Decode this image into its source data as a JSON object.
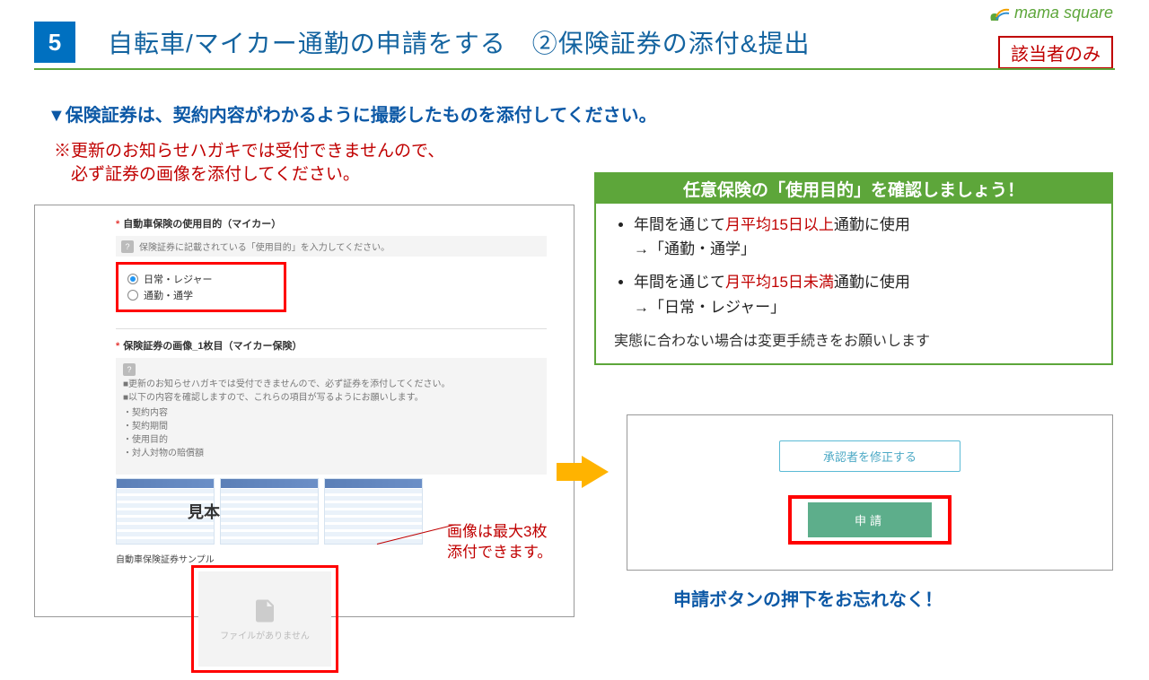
{
  "header": {
    "number": "5",
    "title": "自転車/マイカー通勤の申請をする　②保険証券の添付&提出",
    "logo_text": "mama square",
    "tag": "該当者のみ"
  },
  "instruction": {
    "main": "▼保険証券は、契約内容がわかるように撮影したものを添付してください。",
    "warn_l1": "※更新のお知らせハガキでは受付できませんので、",
    "warn_l2": "　必ず証券の画像を添付してください。"
  },
  "left": {
    "section1_label": "自動車保険の使用目的（マイカー）",
    "section1_note": "保険証券に記載されている「使用目的」を入力してください。",
    "radio1": "日常・レジャー",
    "radio2": "通勤・通学",
    "section2_label": "保険証券の画像_1枚目（マイカー保険）",
    "section2_note_l1": "■更新のお知らせハガキでは受付できませんので、必ず証券を添付してください。",
    "section2_note_l2": "■以下の内容を確認しますので、これらの項目が写るようにお願いします。",
    "bullets": [
      "・契約内容",
      "・契約期間",
      "・使用目的",
      "・対人対物の賠償額"
    ],
    "sample_overlay": "見本",
    "sample_caption": "自動車保険証券サンプル",
    "file_placeholder": "ファイルがありません"
  },
  "callout": {
    "l1": "画像は最大3枚",
    "l2": "添付できます。"
  },
  "info": {
    "header": "任意保険の「使用目的」を確認しましょう！",
    "item1_pre": "年間を通じて",
    "item1_red": "月平均15日以上",
    "item1_post": "通勤に使用",
    "item1_arrow": "→「通勤・通学」",
    "item2_pre": "年間を通じて",
    "item2_red": "月平均15日未満",
    "item2_post": "通勤に使用",
    "item2_arrow": "→「日常・レジャー」",
    "foot": "実態に合わない場合は変更手続きをお願いします"
  },
  "right": {
    "edit_btn": "承認者を修正する",
    "submit_btn": "申請"
  },
  "submit_note": "申請ボタンの押下をお忘れなく！"
}
